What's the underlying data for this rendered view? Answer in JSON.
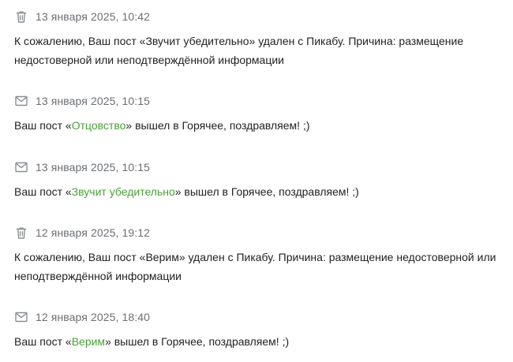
{
  "colors": {
    "text": "#222222",
    "meta": "#6b6f73",
    "link": "#4c9f38",
    "icon": "#8a8f94"
  },
  "notifications": [
    {
      "icon": "trash-icon",
      "date": "13 января 2025, 10:42",
      "text": "К сожалению, Ваш пост «Звучит убедительно» удален с Пикабу. Причина: размещение недостоверной или неподтверждённой информации"
    },
    {
      "icon": "mail-icon",
      "date": "13 января 2025, 10:15",
      "prefix": "Ваш пост «",
      "link": "Отцовство",
      "suffix": "» вышел в Горячее, поздравляем! ;)"
    },
    {
      "icon": "mail-icon",
      "date": "13 января 2025, 10:15",
      "prefix": "Ваш пост «",
      "link": "Звучит убедительно",
      "suffix": "» вышел в Горячее, поздравляем! ;)"
    },
    {
      "icon": "trash-icon",
      "date": "12 января 2025, 19:12",
      "text": "К сожалению, Ваш пост «Верим» удален с Пикабу. Причина: размещение недостоверной или неподтверждённой информации"
    },
    {
      "icon": "mail-icon",
      "date": "12 января 2025, 18:40",
      "prefix": "Ваш пост «",
      "link": "Верим",
      "suffix": "» вышел в Горячее, поздравляем! ;)"
    }
  ]
}
